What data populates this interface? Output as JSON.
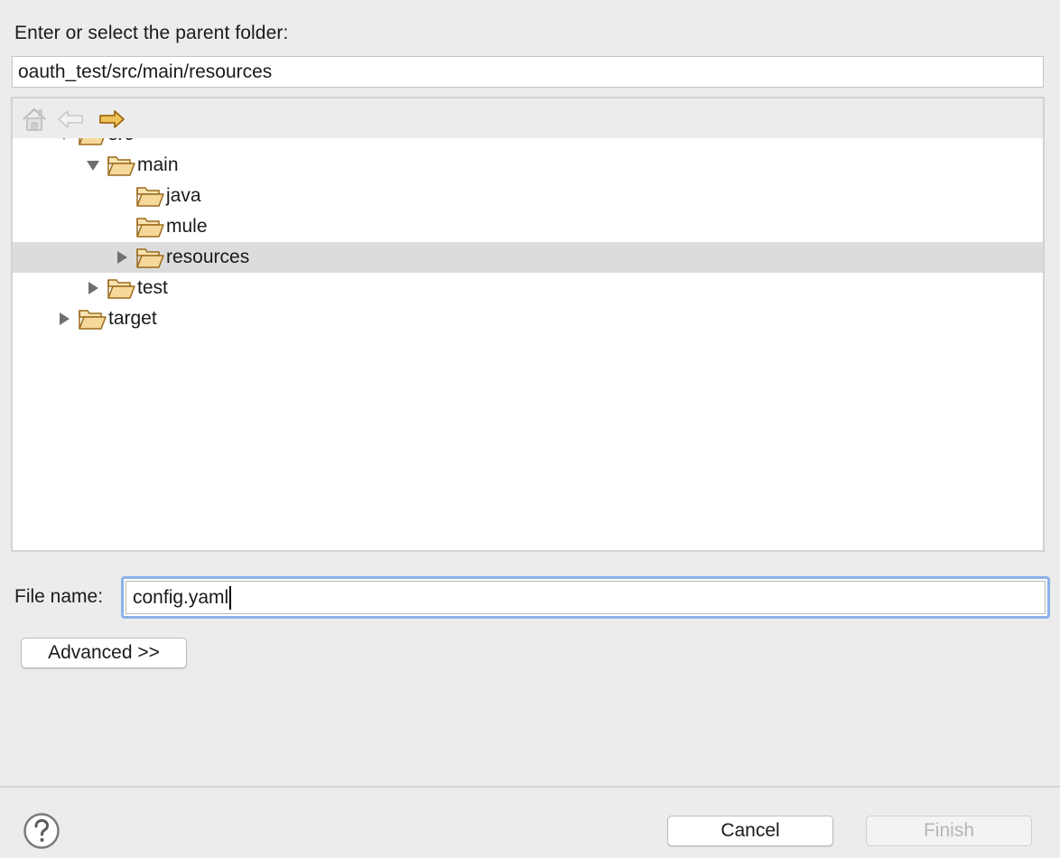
{
  "dialog": {
    "prompt_label": "Enter or select the parent folder:",
    "folder_path_value": "oauth_test/src/main/resources"
  },
  "tree": {
    "rows": [
      {
        "label": "src",
        "expanded": true,
        "has_children": true
      },
      {
        "label": "main",
        "expanded": true,
        "has_children": true
      },
      {
        "label": "java",
        "expanded": false,
        "has_children": false
      },
      {
        "label": "mule",
        "expanded": false,
        "has_children": false
      },
      {
        "label": "resources",
        "expanded": false,
        "has_children": true,
        "selected": true
      },
      {
        "label": "test",
        "expanded": false,
        "has_children": true
      },
      {
        "label": "target",
        "expanded": false,
        "has_children": true
      }
    ]
  },
  "filename": {
    "label": "File name:",
    "value": "config.yaml"
  },
  "buttons": {
    "advanced_label": "Advanced >>",
    "cancel_label": "Cancel",
    "finish_label": "Finish"
  },
  "icons": {
    "toolbar": [
      "home-icon",
      "back-arrow-icon",
      "forward-arrow-icon"
    ],
    "folder": "folder-open-icon",
    "help": "help-icon"
  },
  "colors": {
    "focus_ring": "#8cb0e8",
    "selection_bg": "#dcdcdc",
    "folder_fill": "#f6d89a",
    "folder_stroke": "#9b6a1c",
    "forward_arrow": "#f0c25a"
  }
}
